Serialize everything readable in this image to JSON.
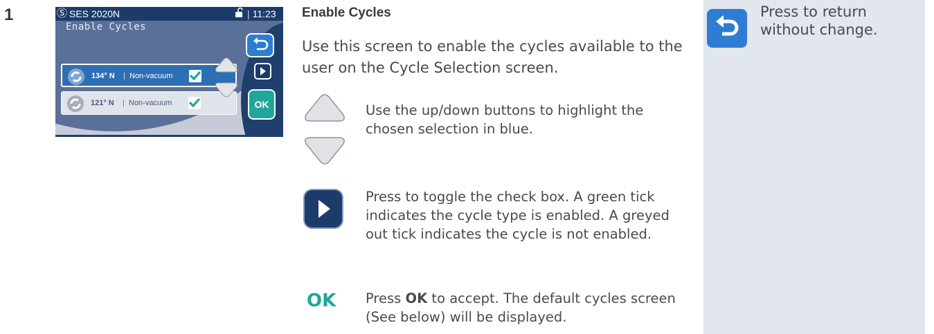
{
  "step_number": "1",
  "device": {
    "model": "SES 2020N",
    "time": "11:23",
    "screen_title": "Enable Cycles",
    "rows": [
      {
        "temp": "134° N",
        "sep": "|",
        "type": "Non-vacuum",
        "checked": true,
        "selected": true
      },
      {
        "temp": "121° N",
        "sep": "|",
        "type": "Non-vacuum",
        "checked": true,
        "selected": false
      }
    ],
    "ok_label": "OK"
  },
  "heading": "Enable Cycles",
  "intro": "Use this screen to enable the cycles available to the user on the Cycle Selection screen.",
  "steps": {
    "updown": "Use the up/down buttons to highlight the chosen selection in blue.",
    "toggle": "Press to toggle the check box. A green tick indicates the cycle type is enabled. A greyed out tick indicates the cycle is not enabled.",
    "ok_prefix": "Press ",
    "ok_bold": "OK",
    "ok_suffix": " to accept.  The default cycles screen (See below) will be displayed.",
    "ok_icon_label": "OK"
  },
  "side": {
    "back_text": "Press to return without change."
  },
  "colors": {
    "navy": "#1b3b6b",
    "blue": "#2e7dd2",
    "teal": "#1fa59a",
    "green_tick": "#20a79c",
    "side_bg": "#e2e6ee"
  }
}
